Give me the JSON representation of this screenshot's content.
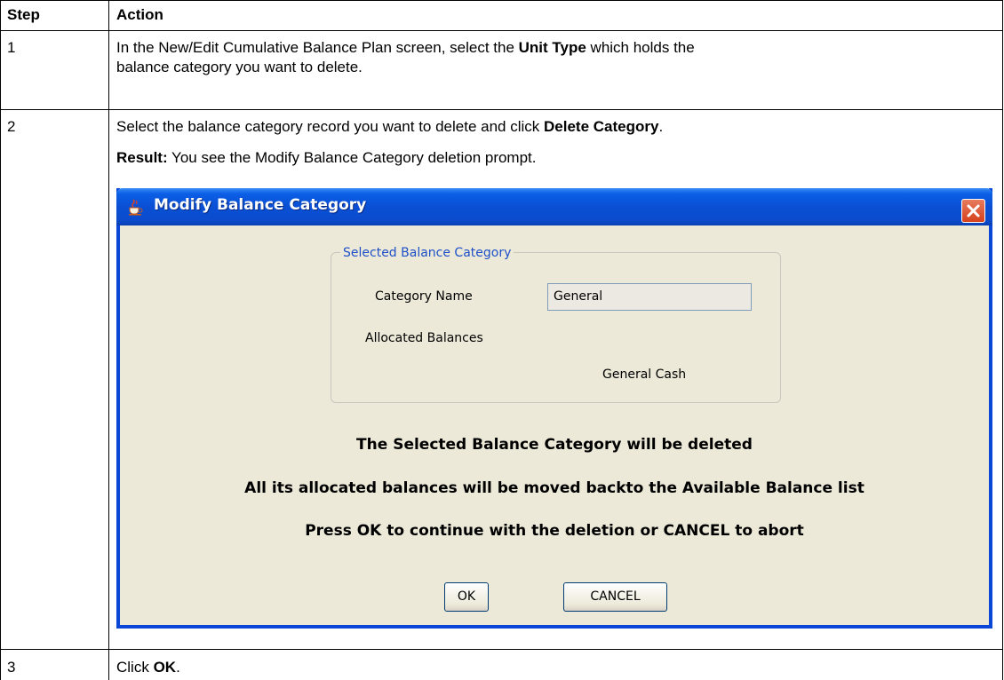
{
  "table": {
    "headers": {
      "step": "Step",
      "action": "Action"
    },
    "row1": {
      "step": "1",
      "text_a": "In the New/Edit Cumulative Balance Plan screen, select the ",
      "bold": "Unit Type",
      "text_b": " which holds the",
      "text_c": "balance category you want to delete."
    },
    "row2": {
      "step": "2",
      "text_a": "Select the balance category record you want to delete and click ",
      "bold": "Delete Category",
      "text_b": ".",
      "result_label": "Result:",
      "result_text": " You see the Modify Balance Category deletion prompt."
    },
    "row3": {
      "step": "3",
      "text_a": "Click ",
      "bold": "OK",
      "text_b": "."
    }
  },
  "dialog": {
    "title": "Modify Balance Category",
    "group_title": "Selected Balance Category",
    "category_name_label": "Category Name",
    "category_name_value": "General",
    "allocated_balances_label": "Allocated Balances",
    "allocated_item": "General Cash",
    "message_1": "The Selected Balance Category will be deleted",
    "message_2": "All its allocated balances will be moved backto the Available Balance list",
    "message_3": "Press OK to continue with the deletion or CANCEL to abort",
    "ok_label": "OK",
    "cancel_label": "CANCEL"
  },
  "colors": {
    "titlebar": "#0b4ccd",
    "dialog_bg": "#ece9d8",
    "group_title": "#1e50c8",
    "close_button": "#d5411d"
  }
}
